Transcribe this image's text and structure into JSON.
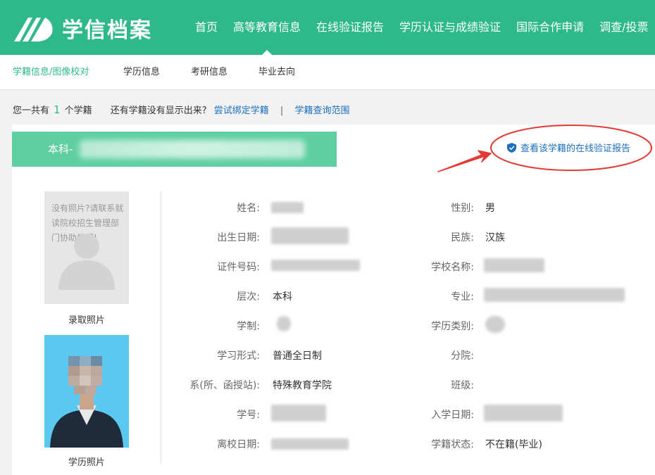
{
  "header": {
    "logo_text": "学信档案",
    "nav": [
      "首页",
      "高等教育信息",
      "在线验证报告",
      "学历认证与成绩验证",
      "国际合作申请",
      "调查/投票"
    ],
    "accent_color": "#2fb98b"
  },
  "subnav": {
    "items": [
      "学籍信息/图像校对",
      "学历信息",
      "考研信息",
      "毕业去向"
    ]
  },
  "summary": {
    "prefix": "您一共有",
    "count": "1",
    "suffix": "个学籍",
    "question": "还有学籍没有显示出来?",
    "bind_link": "尝试绑定学籍",
    "separator": "|",
    "range_link": "学籍查询范围"
  },
  "record": {
    "banner_label": "本科-",
    "verify_link": "查看该学籍的在线验证报告",
    "admission_photo": {
      "placeholder_text": "没有照片?请联系就读院校招生管理部门协助处理!",
      "caption": "录取照片"
    },
    "education_photo": {
      "caption": "学历照片"
    },
    "fields_left": [
      {
        "label": "姓名:",
        "value": ""
      },
      {
        "label": "出生日期:",
        "value": ""
      },
      {
        "label": "证件号码:",
        "value": ""
      },
      {
        "label": "层次:",
        "value": "本科"
      },
      {
        "label": "学制:",
        "value": ""
      },
      {
        "label": "学习形式:",
        "value": "普通全日制"
      },
      {
        "label": "系(所、函授站):",
        "value": "特殊教育学院"
      },
      {
        "label": "学号:",
        "value": ""
      },
      {
        "label": "离校日期:",
        "value": ""
      }
    ],
    "fields_right": [
      {
        "label": "性别:",
        "value": "男"
      },
      {
        "label": "民族:",
        "value": "汉族"
      },
      {
        "label": "学校名称:",
        "value": ""
      },
      {
        "label": "专业:",
        "value": ""
      },
      {
        "label": "学历类别:",
        "value": ""
      },
      {
        "label": "分院:",
        "value": ""
      },
      {
        "label": "班级:",
        "value": ""
      },
      {
        "label": "入学日期:",
        "value": ""
      },
      {
        "label": "学籍状态:",
        "value": "不在籍(毕业)"
      }
    ]
  }
}
